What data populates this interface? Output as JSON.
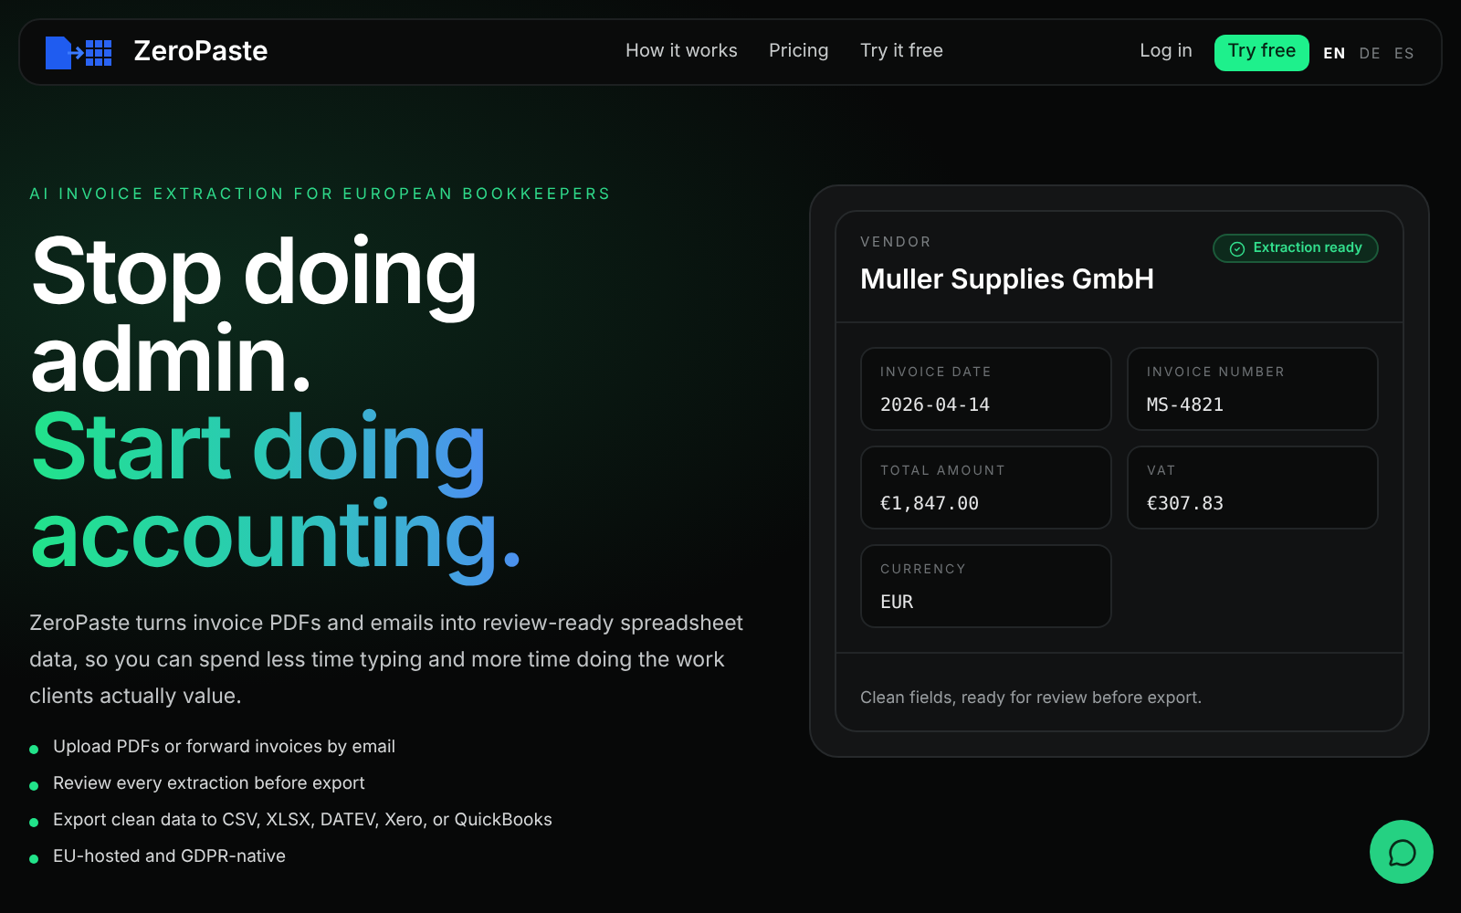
{
  "nav": {
    "brand": "ZeroPaste",
    "links": [
      "How it works",
      "Pricing",
      "Try it free"
    ],
    "login": "Log in",
    "cta": "Try free",
    "languages": [
      {
        "label": "EN",
        "selected": true
      },
      {
        "label": "DE",
        "selected": false
      },
      {
        "label": "ES",
        "selected": false
      }
    ]
  },
  "hero": {
    "eyebrow": "AI INVOICE EXTRACTION FOR EUROPEAN BOOKKEEPERS",
    "headline": [
      {
        "text": "Stop doing",
        "kind": "plain"
      },
      {
        "text": "admin.",
        "kind": "plain"
      },
      {
        "text": "Start doing",
        "kind": "gradient"
      },
      {
        "text": "accounting.",
        "kind": "gradient"
      }
    ],
    "description": "ZeroPaste turns invoice PDFs and emails into review-ready spreadsheet data, so you can spend less time typing and more time doing the work clients actually value.",
    "bullets": [
      "Upload PDFs or forward invoices by email",
      "Review every extraction before export",
      "Export clean data to CSV, XLSX, DATEV, Xero, or QuickBooks",
      "EU-hosted and GDPR-native"
    ]
  },
  "card": {
    "vendor_label": "VENDOR",
    "vendor": "Muller Supplies GmbH",
    "status": "Extraction ready",
    "fields": [
      {
        "label": "INVOICE DATE",
        "value": "2026-04-14"
      },
      {
        "label": "INVOICE NUMBER",
        "value": "MS-4821"
      },
      {
        "label": "TOTAL AMOUNT",
        "value": "€1,847.00"
      },
      {
        "label": "VAT",
        "value": "€307.83"
      },
      {
        "label": "CURRENCY",
        "value": "EUR"
      }
    ],
    "footer": "Clean fields, ready for review before export."
  }
}
